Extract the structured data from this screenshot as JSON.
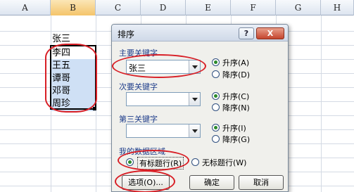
{
  "columns": [
    "A",
    "B",
    "C",
    "D",
    "E",
    "F",
    "G",
    "H"
  ],
  "cells": {
    "header": "张三",
    "names": [
      "李四",
      "王五",
      "谭哥",
      "邓哥",
      "周珍"
    ]
  },
  "dialog": {
    "title": "排序",
    "help_label": "?",
    "close_label": "X",
    "primary_key": {
      "label": "主要关键字",
      "value": "张三",
      "asc": "升序(A)",
      "desc": "降序(D)"
    },
    "secondary_key": {
      "label": "次要关键字",
      "value": "",
      "asc": "升序(C)",
      "desc": "降序(N)"
    },
    "tertiary_key": {
      "label": "第三关键字",
      "value": "",
      "asc": "升序(I)",
      "desc": "降序(G)"
    },
    "data_range": {
      "label": "我的数据区域",
      "has_header": "有标题行(R)",
      "no_header": "无标题行(W)"
    },
    "options_button": "选项(O)...",
    "ok_button": "确定",
    "cancel_button": "取消"
  }
}
